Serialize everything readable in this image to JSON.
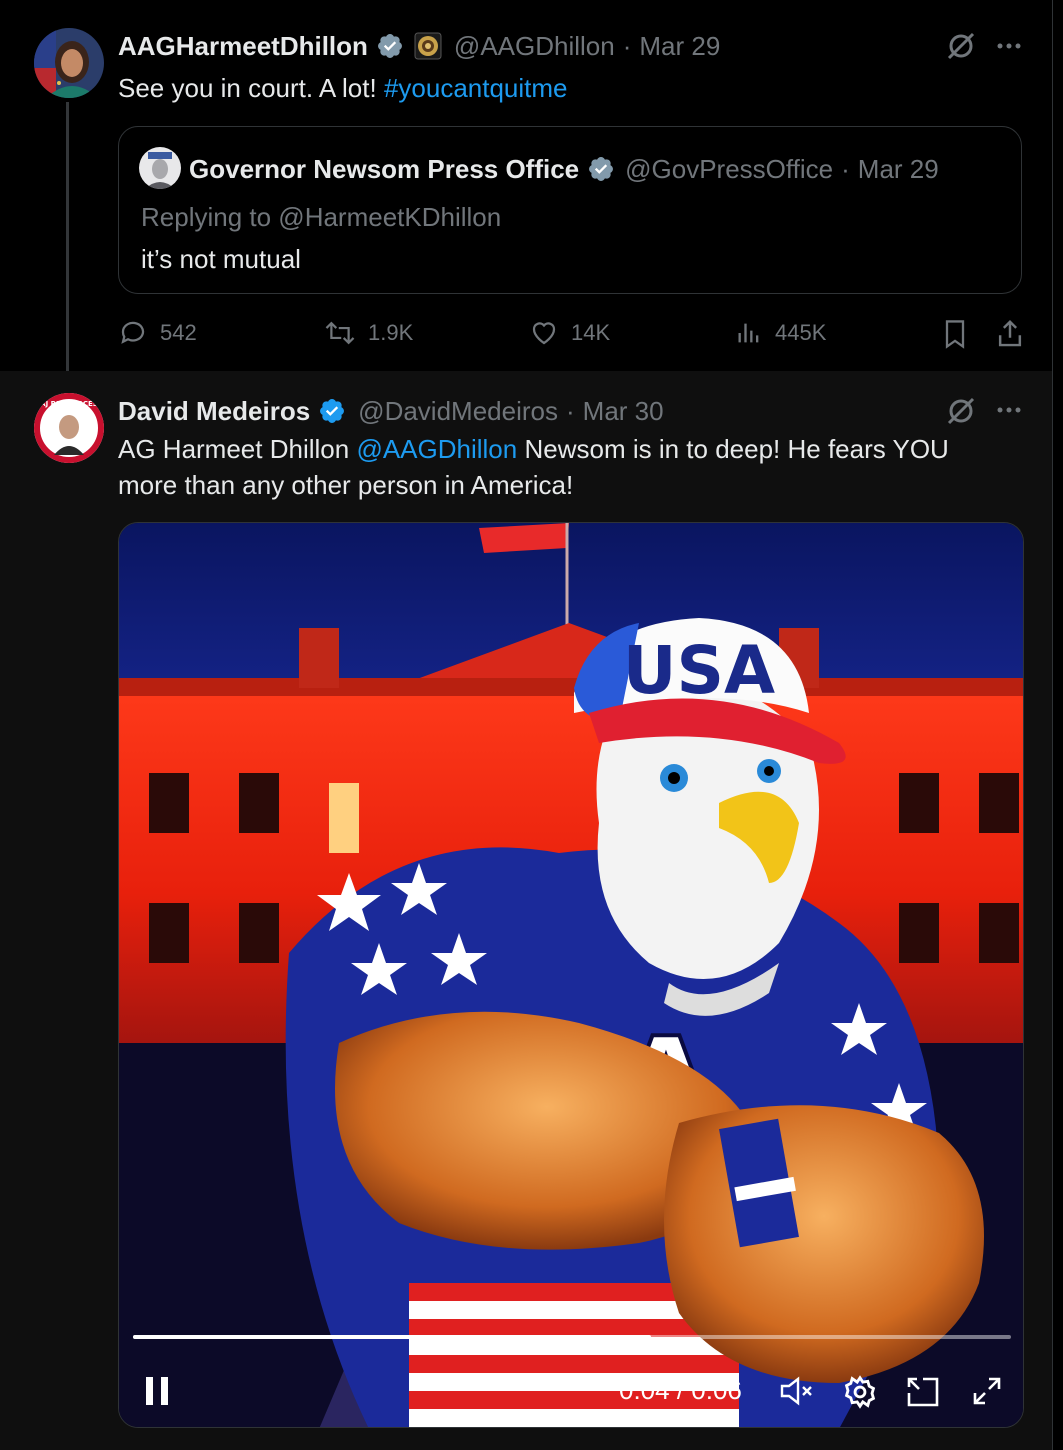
{
  "tweet1": {
    "name": "AAGHarmeetDhillon",
    "handle": "@AAGDhillon",
    "sep": "·",
    "date": "Mar 29",
    "text": "See you in court. A lot!",
    "hashtag": "#youcantquitme",
    "quote": {
      "name": "Governor Newsom Press Office",
      "handle": "@GovPressOffice",
      "sep": "·",
      "date": "Mar 29",
      "replying": "Replying to @HarmeetKDhillon",
      "text": "it’s not mutual"
    },
    "stats": {
      "replies": "542",
      "reposts": "1.9K",
      "likes": "14K",
      "views": "445K"
    }
  },
  "tweet2": {
    "name": "David Medeiros",
    "handle": "@DavidMedeiros",
    "sep": "·",
    "date": "Mar 30",
    "text_prefix": "AG Harmeet Dhillon",
    "mention": "@AAGDhillon",
    "text_line1_suffix": "Newsom is in to deep! He fears YOU",
    "text_line2": "more than any other person in America!",
    "video": {
      "time": "0:04 / 0:06",
      "progress": 0.59,
      "cap_text": "USA",
      "shirt_text": "USA",
      "avatar_text": "AJ RESOURCES"
    }
  },
  "icons": [
    "verified-badge-icon",
    "gov-seal-icon",
    "grok-icon",
    "more-icon",
    "reply-icon",
    "repost-icon",
    "like-icon",
    "views-icon",
    "bookmark-icon",
    "share-icon",
    "pause-icon",
    "mute-icon",
    "settings-icon",
    "pip-icon",
    "fullscreen-icon"
  ],
  "colors": {
    "accent": "#1d9bf0",
    "muted": "#71767b",
    "text": "#e7e9ea",
    "background": "#000000"
  }
}
